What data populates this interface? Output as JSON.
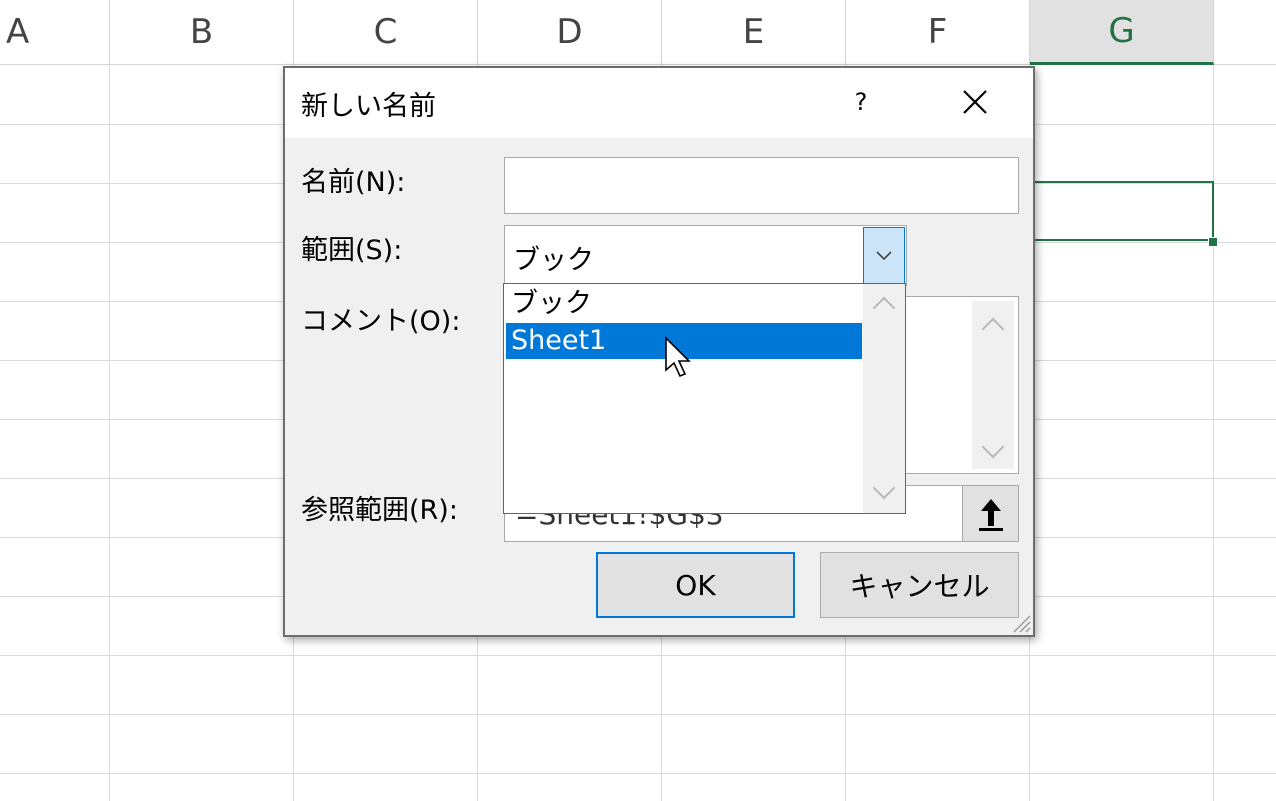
{
  "sheet": {
    "columns": [
      "A",
      "B",
      "C",
      "D",
      "E",
      "F",
      "G"
    ],
    "selected_column": "G"
  },
  "dialog": {
    "title": "新しい名前",
    "help_label": "?",
    "close_label": "×",
    "name_label": "名前(N):",
    "name_value": "",
    "scope_label": "範囲(S):",
    "scope_value": "ブック",
    "comment_label": "コメント(O):",
    "comment_value": "",
    "ref_label": "参照範囲(R):",
    "ref_value": "=Sheet1!$G$3",
    "ok_label": "OK",
    "cancel_label": "キャンセル"
  },
  "dropdown": {
    "options": [
      "ブック",
      "Sheet1"
    ],
    "highlighted": "Sheet1"
  },
  "colors": {
    "accent": "#0078d7",
    "excel_green": "#217346",
    "dialog_bg": "#f0f0f0"
  },
  "icons": {
    "close": "close-icon",
    "dropdown_arrow": "chevron-down-icon",
    "collapse": "arrow-up-icon",
    "cursor": "mouse-pointer-icon"
  }
}
